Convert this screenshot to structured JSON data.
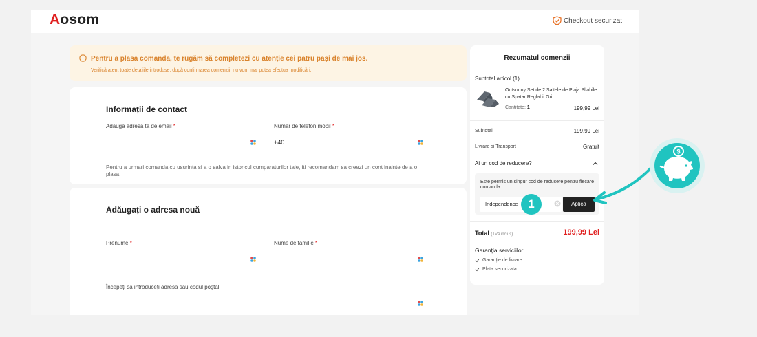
{
  "header": {
    "logo_first": "A",
    "logo_rest": "osom",
    "secure_label": "Checkout securizat"
  },
  "notice": {
    "title": "Pentru a plasa comanda, te rugăm să completezi cu atenție cei patru pași de mai jos.",
    "subtitle": "Verifică atent toate detaliile introduse; după confirmarea comenzii, nu vom mai putea efectua modificări."
  },
  "contact": {
    "title": "Informații de contact",
    "email_label": "Adauga adresa ta de email",
    "phone_label": "Numar de telefon mobil",
    "phone_value": "+40",
    "hint": "Pentru a urmari comanda cu usurinta si a o salva in istoricul cumparaturilor tale, iti recomandam sa creezi un cont inainte de a o plasa."
  },
  "address": {
    "title": "Adăugați o adresa nouă",
    "first_name_label": "Prenume",
    "last_name_label": "Nume de familie",
    "address_label": "Începeți să introduceți adresa sau codul poștal"
  },
  "summary": {
    "title": "Rezumatul comenzii",
    "subtotal_items": "Subtotal articol (1)",
    "product_name": "Outsunny Set de 2 Saltele de Plaja Pliabile cu Spatar Reglabil Gri",
    "qty_label": "Cantitate:",
    "qty_value": "1",
    "product_price": "199,99 Lei",
    "subtotal_label": "Subtotal",
    "subtotal_value": "199,99 Lei",
    "shipping_label": "Livrare si Transport",
    "shipping_value": "Gratuit",
    "discount_question": "Ai un cod de reducere?",
    "discount_note": "Este permis un singur cod de reducere pentru fiecare comanda",
    "discount_code": "Independence",
    "apply_label": "Aplica",
    "total_label": "Total",
    "total_tax": "(TVA inclus)",
    "total_value": "199,99 Lei",
    "guarantee_title": "Garanția serviciilor",
    "guarantee_items": [
      "Garanție de livrare",
      "Plata securizata"
    ]
  },
  "annotation": {
    "step_number": "1",
    "accent_color": "#20c4c0"
  }
}
